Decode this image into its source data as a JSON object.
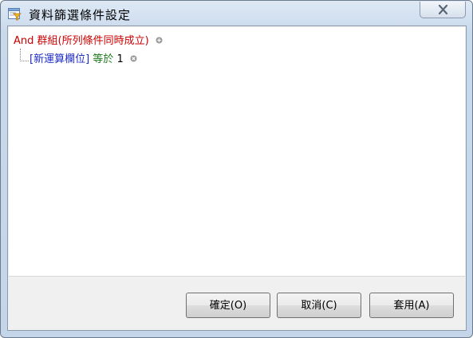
{
  "window": {
    "title": "資料篩選條件設定",
    "icon": "filter-funnel-icon"
  },
  "tree": {
    "group": {
      "operator": "And",
      "label": "群組(所列條件同時成立)",
      "add_icon": "plus-circle-icon"
    },
    "conditions": [
      {
        "field": "[新運算欄位]",
        "operator": "等於",
        "value": "1",
        "remove_icon": "remove-circle-icon"
      }
    ]
  },
  "buttons": {
    "ok": "確定(O)",
    "cancel": "取消(C)",
    "apply": "套用(A)"
  },
  "colors": {
    "group": "#cc0000",
    "field": "#1c2bc6",
    "operator": "#1a7a1a"
  }
}
